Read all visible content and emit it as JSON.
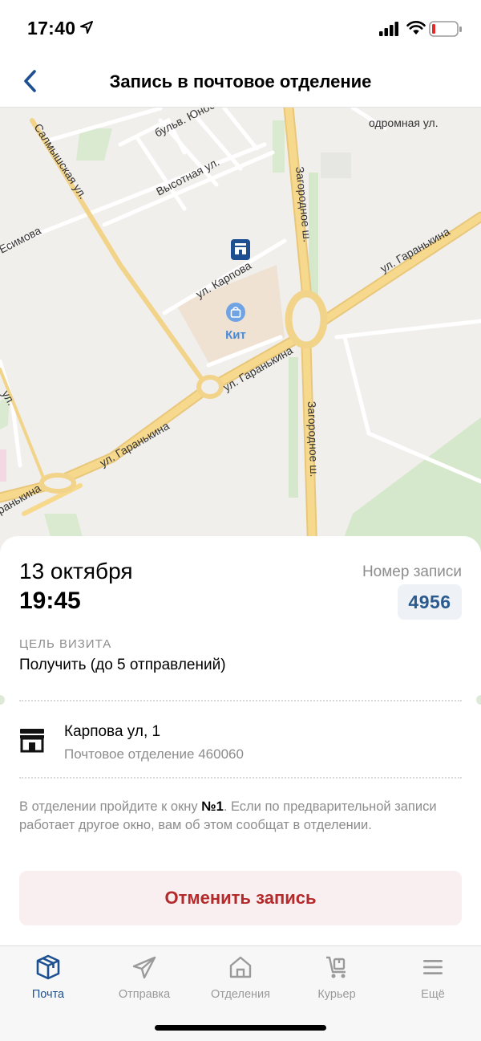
{
  "status_bar": {
    "time": "17:40"
  },
  "nav": {
    "title": "Запись в почтовое отделение"
  },
  "map": {
    "labels": {
      "salmyshskaya": "Салмышская ул.",
      "bulv": "бульв. Юност",
      "vysotnaya": "Высотная ул.",
      "esimova": "Есимова",
      "aerodromnaya": "одромная ул.",
      "zagorodnoe_top": "Загородное ш.",
      "zagorodnoe_bottom": "Загородное ш.",
      "karpova": "ул. Карпова",
      "kit": "Кит",
      "garankina_right": "ул. Гаранькина",
      "garankina_mid": "ул. Гаранькина",
      "garankina_left": "ул. Гаранькина",
      "garankina_edge": "ранькина",
      "ul_left": "ул."
    }
  },
  "appointment": {
    "date": "13 октября",
    "time": "19:45",
    "number_label": "Номер записи",
    "number": "4956",
    "purpose_label": "ЦЕЛЬ ВИЗИТА",
    "purpose": "Получить (до 5 отправлений)",
    "address": "Карпова ул, 1",
    "office": "Почтовое отделение 460060",
    "info_prefix": "В отделении пройдите к окну ",
    "info_window": "№1",
    "info_suffix": ". Если по предварительной записи работает другое окно, вам об этом сообщат в отделении.",
    "cancel_label": "Отменить запись"
  },
  "tabbar": {
    "tabs": [
      {
        "label": "Почта"
      },
      {
        "label": "Отправка"
      },
      {
        "label": "Отделения"
      },
      {
        "label": "Курьер"
      },
      {
        "label": "Ещё"
      }
    ]
  },
  "colors": {
    "accent": "#1d4f91",
    "danger": "#b42a2a"
  }
}
